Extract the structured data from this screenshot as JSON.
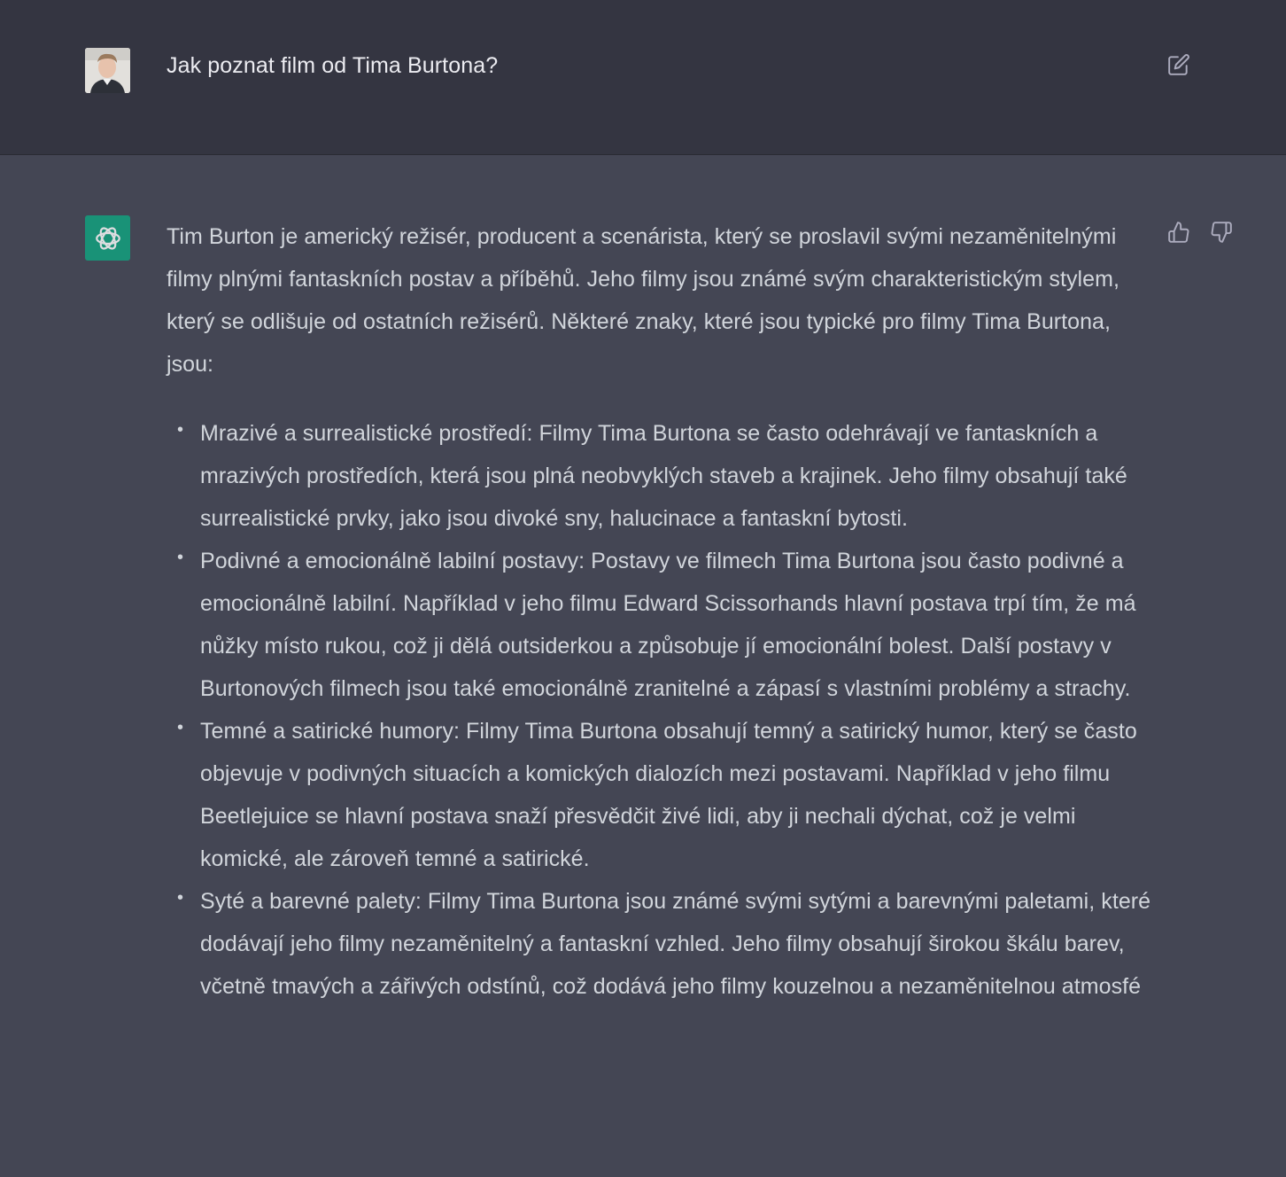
{
  "user_message": {
    "text": "Jak poznat film od Tima Burtona?",
    "avatar": "user-photo-avatar"
  },
  "assistant_message": {
    "avatar": "chatgpt-logo",
    "brand_color": "#10a37f",
    "intro": "Tim Burton je americký režisér, producent a scenárista, který se proslavil svými nezaměnitelnými filmy plnými fantaskních postav a příběhů. Jeho filmy jsou známé svým charakteristickým stylem, který se odlišuje od ostatních režisérů. Některé znaky, které jsou typické pro filmy Tima Burtona, jsou:",
    "items": [
      "Mrazivé a surrealistické prostředí: Filmy Tima Burtona se často odehrávají ve fantaskních a mrazivých prostředích, která jsou plná neobvyklých staveb a krajinek. Jeho filmy obsahují také surrealistické prvky, jako jsou divoké sny, halucinace a fantaskní bytosti.",
      "Podivné a emocionálně labilní postavy: Postavy ve filmech Tima Burtona jsou často podivné a emocionálně labilní. Například v jeho filmu Edward Scissorhands hlavní postava trpí tím, že má nůžky místo rukou, což ji dělá outsiderkou a způsobuje jí emocionální bolest. Další postavy v Burtonových filmech jsou také emocionálně zranitelné a zápasí s vlastními problémy a strachy.",
      "Temné a satirické humory: Filmy Tima Burtona obsahují temný a satirický humor, který se často objevuje v podivných situacích a komických dialozích mezi postavami. Například v jeho filmu Beetlejuice se hlavní postava snaží přesvědčit živé lidi, aby ji nechali dýchat, což je velmi komické, ale zároveň temné a satirické.",
      "Syté a barevné palety: Filmy Tima Burtona jsou známé svými sytými a barevnými paletami, které dodávají jeho filmy nezaměnitelný a fantaskní vzhled. Jeho filmy obsahují širokou škálu barev, včetně tmavých a zářivých odstínů, což dodává jeho filmy kouzelnou a nezaměnitelnou atmosfé"
    ]
  },
  "colors": {
    "user_row_bg": "#343541",
    "assistant_row_bg": "#444654",
    "text": "#d1d5db"
  }
}
